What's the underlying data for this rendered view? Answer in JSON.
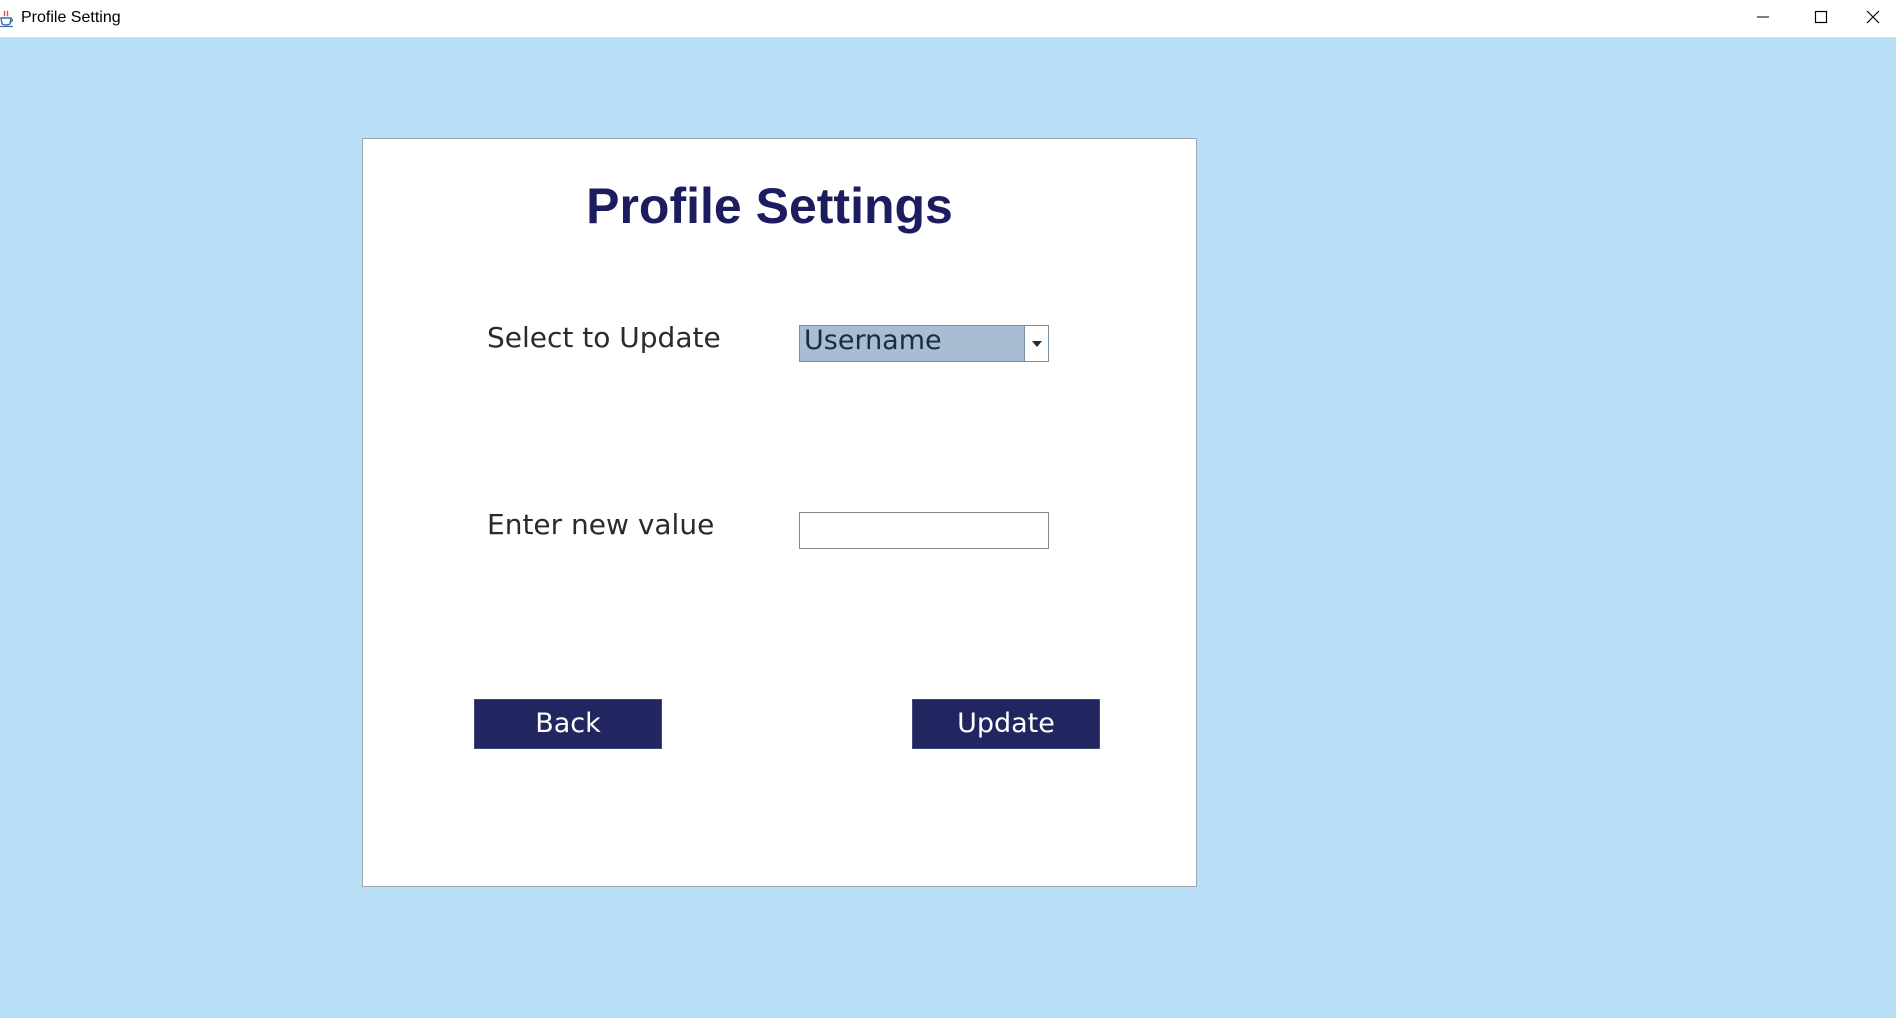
{
  "window": {
    "title": "Profile Setting",
    "icons": {
      "app": "java-cup-icon",
      "minimize": "minimize-icon",
      "maximize": "maximize-icon",
      "close": "close-icon"
    }
  },
  "form": {
    "heading": "Profile Settings",
    "select_label": "Select to Update",
    "select_value": "Username",
    "value_label": "Enter new value",
    "value_input": "",
    "back_label": "Back",
    "update_label": "Update"
  },
  "colors": {
    "background": "#b9dff7",
    "heading": "#1b1d5e",
    "button": "#222660",
    "combo": "#a7bdd4"
  }
}
